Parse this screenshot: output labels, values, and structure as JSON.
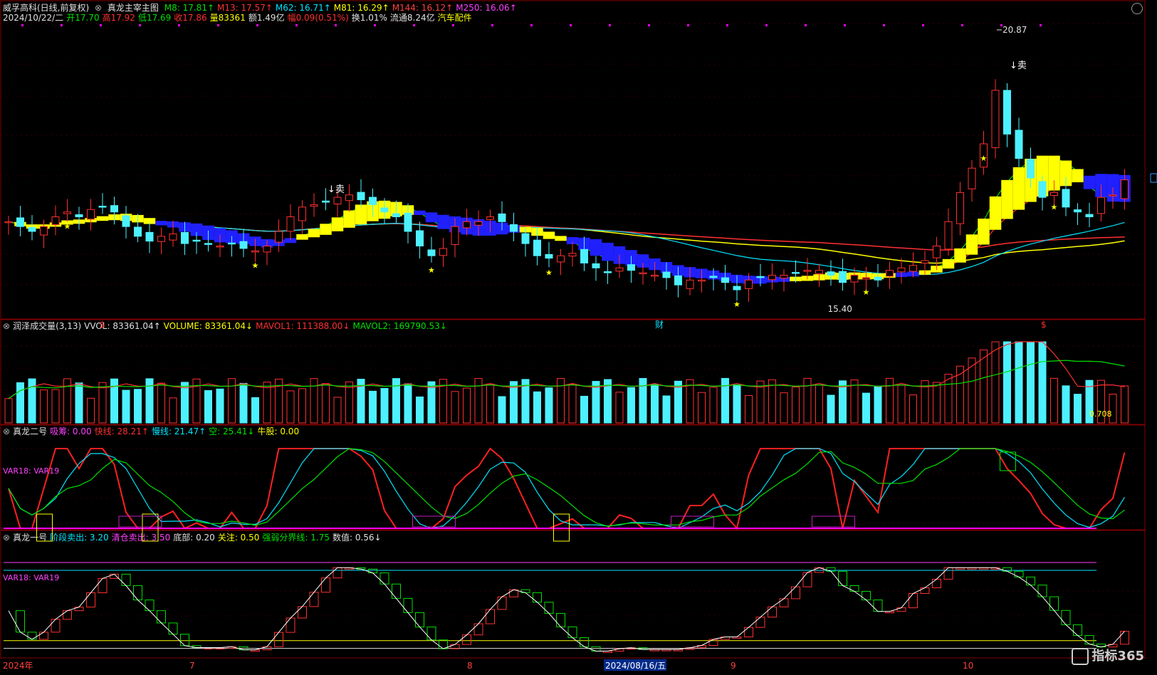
{
  "main": {
    "stock": "威孚高科(日线,前复权)",
    "indicator": "真龙主宰主图",
    "ma": [
      {
        "label": "M8: 17.81↑",
        "color": "#00e000"
      },
      {
        "label": "M13: 17.57↑",
        "color": "#ff3030"
      },
      {
        "label": "M62: 16.71↑",
        "color": "#00e5ff"
      },
      {
        "label": "M81: 16.29↑",
        "color": "#ffff00"
      },
      {
        "label": "M144: 16.12↑",
        "color": "#ff4040"
      },
      {
        "label": "M250: 16.06↑",
        "color": "#ff40ff"
      }
    ],
    "info": [
      {
        "label": "2024/10/22/二",
        "color": "#e0e0e0"
      },
      {
        "label": "开17.70",
        "color": "#00e000"
      },
      {
        "label": "高17.92",
        "color": "#ff3030"
      },
      {
        "label": "低17.69",
        "color": "#00e000"
      },
      {
        "label": "收17.86",
        "color": "#ff3030"
      },
      {
        "label": "量83361",
        "color": "#ffff00"
      },
      {
        "label": "额1.49亿",
        "color": "#e0e0e0"
      },
      {
        "label": "幅0.09(0.51%)",
        "color": "#ff3030"
      },
      {
        "label": "换1.01%",
        "color": "#e0e0e0"
      },
      {
        "label": "流通8.24亿",
        "color": "#e0e0e0"
      },
      {
        "label": "汽车配件",
        "color": "#ffff00"
      }
    ],
    "annotations": {
      "high": "20.87",
      "low": "15.40",
      "sell1": "↓卖",
      "sell2": "↓卖",
      "s1": "$",
      "s2": "$",
      "cai": "财"
    }
  },
  "vol": {
    "title": "润泽成交量(3,13)",
    "items": [
      {
        "label": "VVOL: 83361.04↑",
        "color": "#e0e0e0"
      },
      {
        "label": "VOLUME: 83361.04↓",
        "color": "#ffff00"
      },
      {
        "label": "MAVOL1: 111388.00↓",
        "color": "#ff3030"
      },
      {
        "label": "MAVOL2: 169790.53↓",
        "color": "#00e000"
      }
    ],
    "value_label": "0.708"
  },
  "zl2": {
    "title": "真龙二号",
    "items": [
      {
        "label": "吸筹: 0.00",
        "color": "#ff40ff"
      },
      {
        "label": "快线: 28.21↑",
        "color": "#ff3030"
      },
      {
        "label": "慢线: 21.47↑",
        "color": "#00e5ff"
      },
      {
        "label": "空: 25.41↓",
        "color": "#00e000"
      },
      {
        "label": "牛股: 0.00",
        "color": "#ffff00"
      }
    ],
    "var_label": "VAR18: VAR19"
  },
  "zl1": {
    "title": "真龙一号",
    "items": [
      {
        "label": "阶段卖出: 3.20",
        "color": "#00e5ff"
      },
      {
        "label": "清仓卖出: 3.50",
        "color": "#ff40ff"
      },
      {
        "label": "底部: 0.20",
        "color": "#e0e0e0"
      },
      {
        "label": "关注: 0.50",
        "color": "#ffff00"
      },
      {
        "label": "强弱分界线: 1.75",
        "color": "#00e000"
      },
      {
        "label": "数值: 0.56↓",
        "color": "#e0e0e0"
      }
    ],
    "var_label": "VAR18: VAR19"
  },
  "xaxis": [
    {
      "label": "2024年",
      "color": "#ff4040"
    },
    {
      "label": "7",
      "color": "#ff4040"
    },
    {
      "label": "8",
      "color": "#ff4040"
    },
    {
      "label": "2024/08/16/五",
      "color": "#ffffff"
    },
    {
      "label": "9",
      "color": "#ff4040"
    },
    {
      "label": "10",
      "color": "#ff4040"
    }
  ],
  "logo": "指标365",
  "colors": {
    "up": "#ff3030",
    "down": "#4df0ff",
    "grid": "#800000",
    "ma": "#ffff00"
  },
  "chart_data": {
    "type": "candlestick",
    "closes": [
      17.0,
      16.9,
      16.8,
      16.9,
      17.1,
      17.2,
      17.1,
      17.25,
      17.3,
      17.2,
      16.9,
      16.7,
      16.6,
      16.7,
      16.75,
      16.55,
      16.6,
      16.55,
      16.5,
      16.55,
      16.45,
      16.4,
      16.5,
      16.8,
      17.1,
      17.3,
      17.35,
      17.4,
      17.5,
      17.55,
      17.45,
      17.35,
      17.2,
      17.1,
      16.8,
      16.5,
      16.3,
      16.45,
      16.9,
      17.0,
      17.0,
      17.1,
      17.0,
      16.8,
      16.55,
      16.3,
      16.25,
      16.3,
      16.35,
      16.15,
      16.05,
      15.95,
      16.05,
      16.0,
      15.95,
      15.9,
      15.85,
      15.7,
      15.8,
      15.8,
      15.85,
      15.75,
      15.6,
      15.8,
      15.85,
      15.9,
      15.9,
      15.95,
      16.0,
      16.0,
      15.9,
      15.75,
      15.9,
      15.85,
      15.8,
      16.0,
      16.05,
      16.1,
      16.2,
      16.5,
      17.0,
      17.6,
      18.1,
      18.6,
      19.7,
      18.8,
      18.3,
      17.9,
      17.5,
      17.6,
      17.3,
      17.2,
      17.1,
      17.5,
      17.55,
      17.86
    ]
  }
}
